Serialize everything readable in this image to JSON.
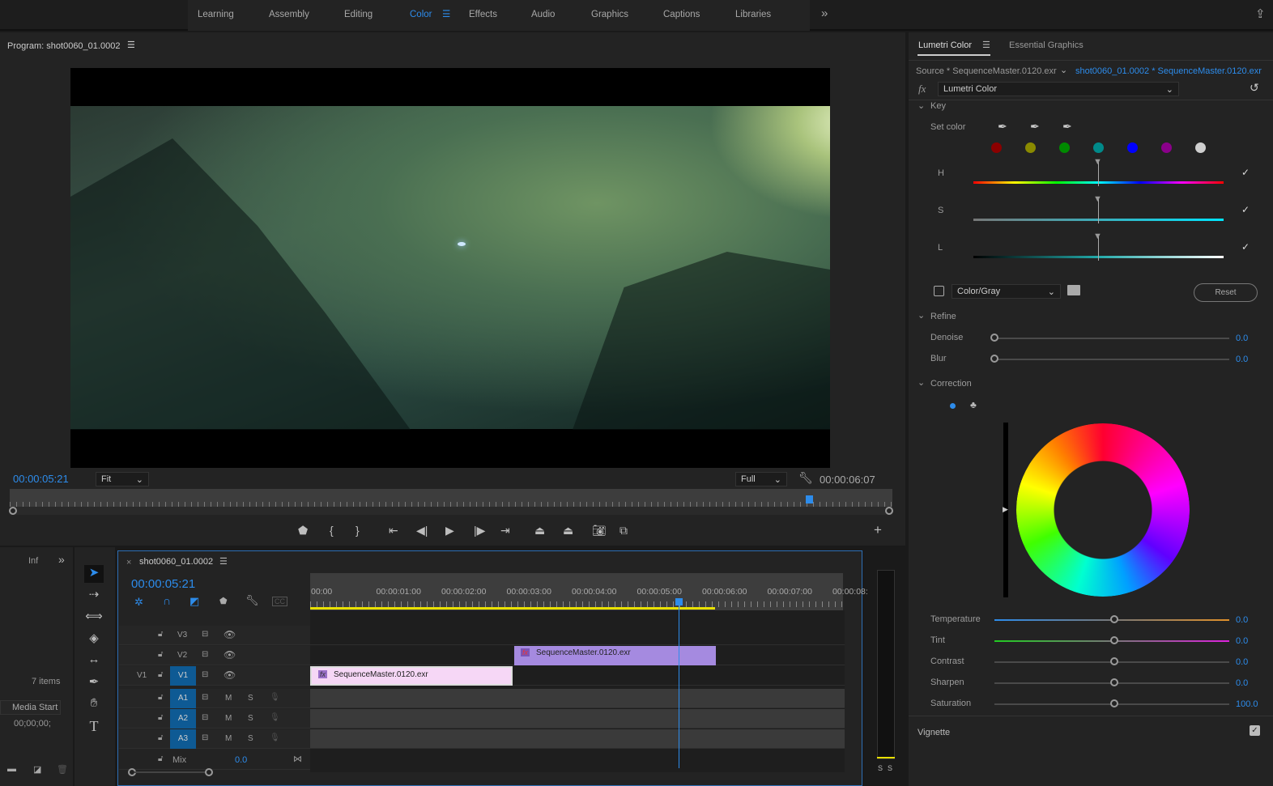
{
  "workspaces": [
    "Learning",
    "Assembly",
    "Editing",
    "Color",
    "Effects",
    "Audio",
    "Graphics",
    "Captions",
    "Libraries"
  ],
  "active_workspace": "Color",
  "program": {
    "title": "Program: shot0060_01.0002",
    "timecode": "00:00:05:21",
    "zoom": "Fit",
    "resolution": "Full",
    "duration": "00:00:06:07",
    "playhead_fraction": 0.91
  },
  "lumetri": {
    "tabs": [
      "Lumetri Color",
      "Essential Graphics"
    ],
    "source": "Source * SequenceMaster.0120.exr",
    "sequence_clip": "shot0060_01.0002 * SequenceMaster.0120.exr",
    "fx_label": "fx",
    "effect": "Lumetri Color",
    "key": {
      "title": "Key",
      "set_color": "Set color",
      "swatches": [
        "#8b0000",
        "#8a8a00",
        "#008a00",
        "#008a8a",
        "#0000ff",
        "#8a008a",
        "#cfcfcf"
      ],
      "h": "H",
      "s": "S",
      "l": "L",
      "mode": "Color/Gray",
      "reset": "Reset"
    },
    "refine": {
      "title": "Refine",
      "denoise_label": "Denoise",
      "denoise": "0.0",
      "blur_label": "Blur",
      "blur": "0.0"
    },
    "correction": {
      "title": "Correction",
      "sliders": [
        {
          "label": "Temperature",
          "value": "0.0"
        },
        {
          "label": "Tint",
          "value": "0.0"
        },
        {
          "label": "Contrast",
          "value": "0.0"
        },
        {
          "label": "Sharpen",
          "value": "0.0"
        },
        {
          "label": "Saturation",
          "value": "100.0"
        }
      ]
    },
    "vignette": "Vignette"
  },
  "project": {
    "tab": "Inf",
    "items": "7 items",
    "column": "Media Start",
    "value": "00;00;00;"
  },
  "timeline": {
    "title": "shot0060_01.0002",
    "timecode": "00:00:05:21",
    "ruler": [
      "00:00",
      "00:00:01:00",
      "00:00:02:00",
      "00:00:03:00",
      "00:00:04:00",
      "00:00:05:00",
      "00:00:06:00",
      "00:00:07:00",
      "00:00:08:"
    ],
    "video_tracks": [
      "V3",
      "V2",
      "V1"
    ],
    "source_patch": "V1",
    "audio_tracks": [
      "A1",
      "A2",
      "A3"
    ],
    "m": "M",
    "s": "S",
    "mix_label": "Mix",
    "mix_value": "0.0",
    "clips": [
      {
        "name": "SequenceMaster.0120.exr",
        "track": "V1"
      },
      {
        "name": "SequenceMaster.0120.exr",
        "track": "V2"
      }
    ]
  },
  "meter": {
    "s1": "S",
    "s2": "S"
  }
}
